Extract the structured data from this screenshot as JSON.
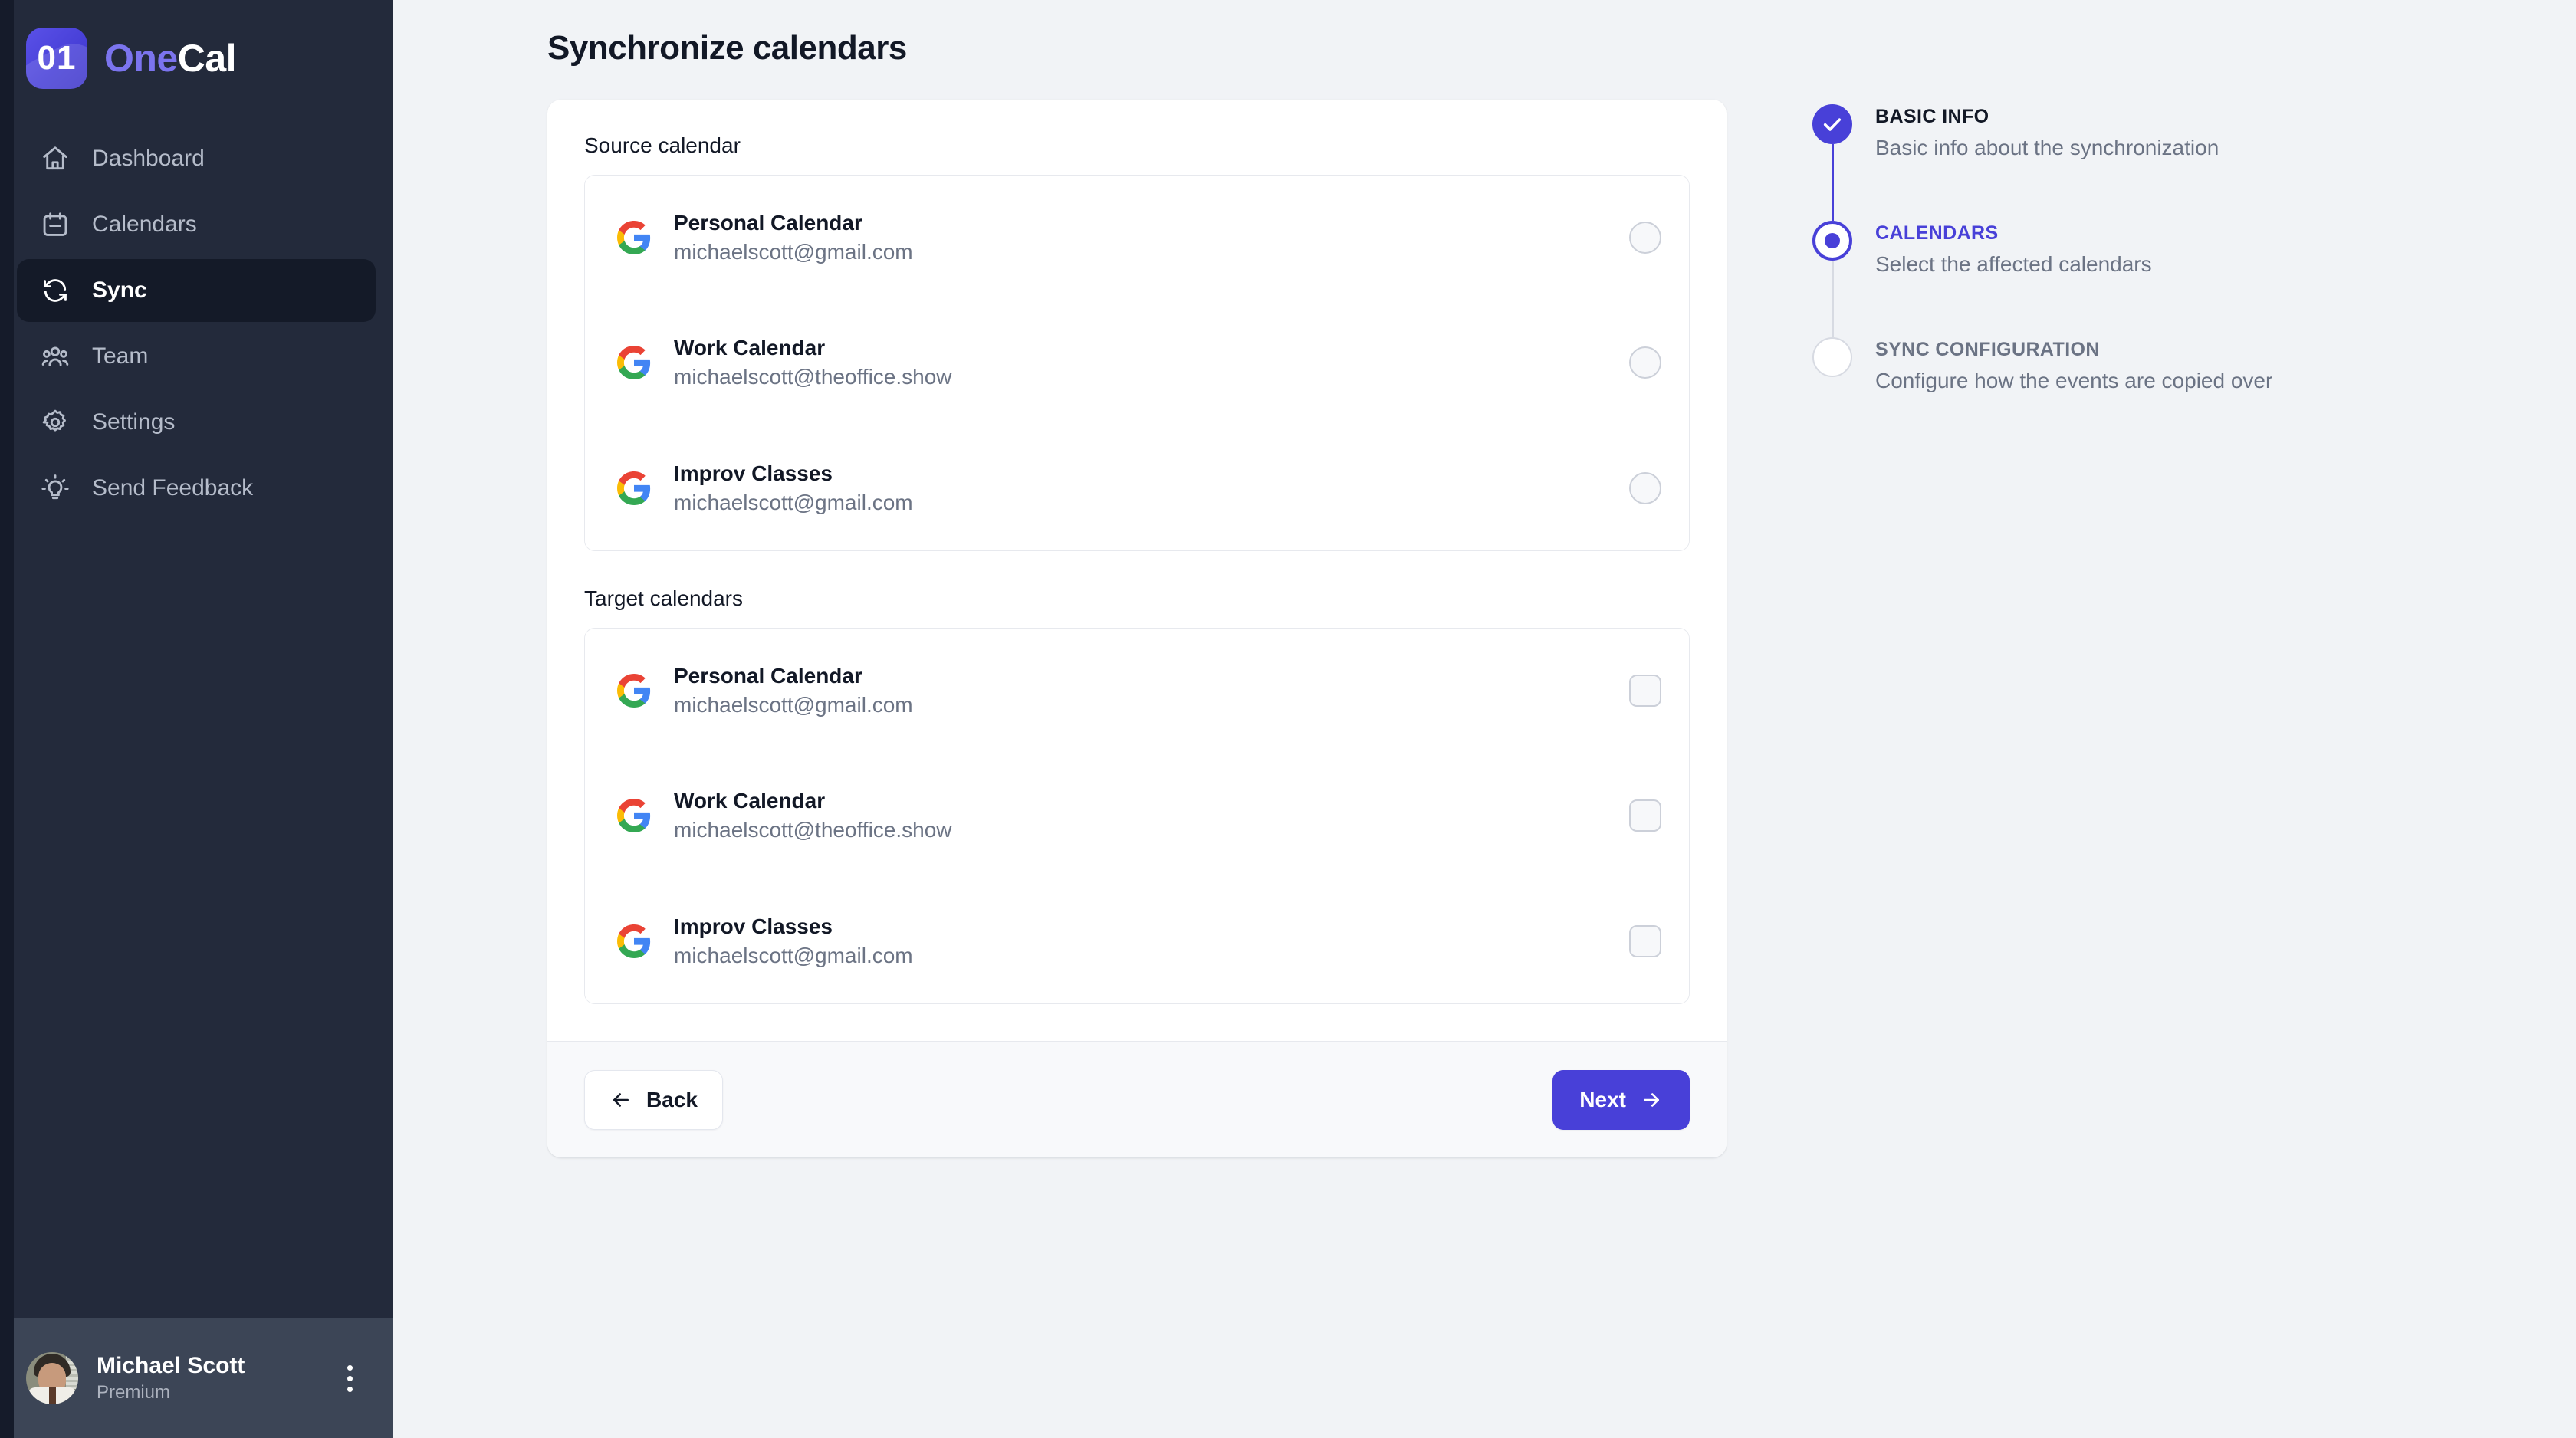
{
  "brand": {
    "mark": "01",
    "name_one": "One",
    "name_cal": "Cal"
  },
  "sidebar": {
    "items": [
      {
        "label": "Dashboard",
        "icon": "home-icon",
        "active": false
      },
      {
        "label": "Calendars",
        "icon": "calendar-icon",
        "active": false
      },
      {
        "label": "Sync",
        "icon": "sync-icon",
        "active": true
      },
      {
        "label": "Team",
        "icon": "team-icon",
        "active": false
      },
      {
        "label": "Settings",
        "icon": "gear-icon",
        "active": false
      },
      {
        "label": "Send Feedback",
        "icon": "lightbulb-icon",
        "active": false
      }
    ],
    "profile": {
      "name": "Michael Scott",
      "plan": "Premium"
    }
  },
  "page": {
    "title": "Synchronize calendars"
  },
  "card": {
    "source_label": "Source calendar",
    "target_label": "Target calendars",
    "source_calendars": [
      {
        "name": "Personal Calendar",
        "email": "michaelscott@gmail.com",
        "provider": "google",
        "selected": false
      },
      {
        "name": "Work Calendar",
        "email": "michaelscott@theoffice.show",
        "provider": "google",
        "selected": false
      },
      {
        "name": "Improv Classes",
        "email": "michaelscott@gmail.com",
        "provider": "google",
        "selected": false
      }
    ],
    "target_calendars": [
      {
        "name": "Personal Calendar",
        "email": "michaelscott@gmail.com",
        "provider": "google",
        "checked": false
      },
      {
        "name": "Work Calendar",
        "email": "michaelscott@theoffice.show",
        "provider": "google",
        "checked": false
      },
      {
        "name": "Improv Classes",
        "email": "michaelscott@gmail.com",
        "provider": "google",
        "checked": false
      }
    ],
    "back_label": "Back",
    "next_label": "Next"
  },
  "stepper": {
    "steps": [
      {
        "title": "BASIC INFO",
        "desc": "Basic info about the synchronization",
        "state": "done"
      },
      {
        "title": "CALENDARS",
        "desc": "Select the affected calendars",
        "state": "current"
      },
      {
        "title": "SYNC CONFIGURATION",
        "desc": "Configure how the events are copied over",
        "state": "todo"
      }
    ]
  },
  "colors": {
    "accent": "#4840d8",
    "sidebar_bg": "#232a3b",
    "sidebar_active_bg": "#141a28",
    "page_bg": "#f1f3f6"
  }
}
